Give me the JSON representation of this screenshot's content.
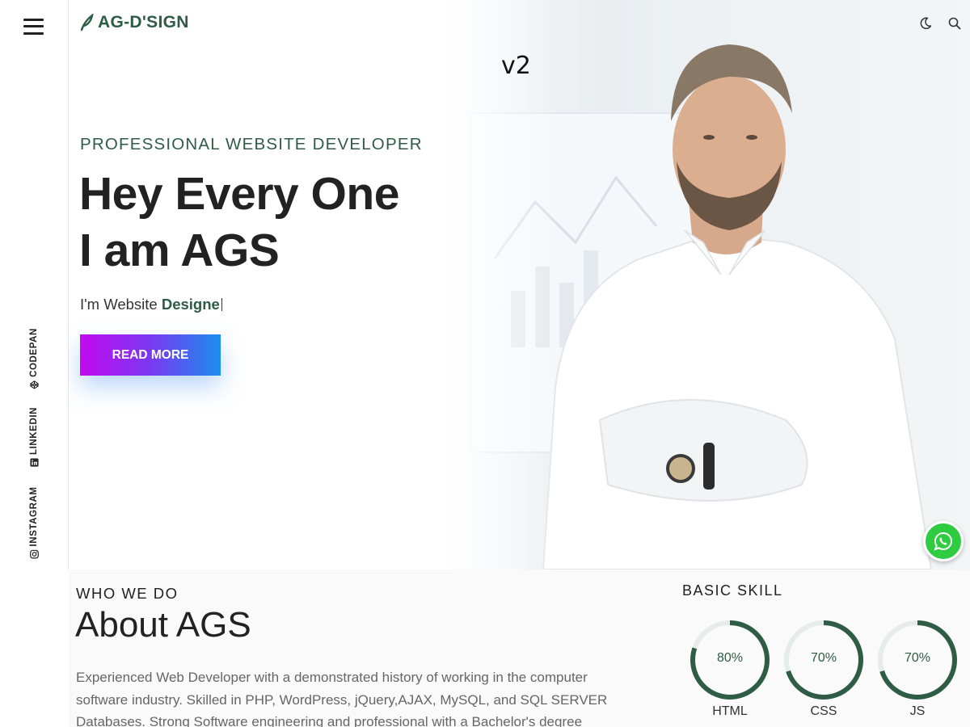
{
  "header": {
    "logo_text": "AG-D'SIGN",
    "version_label": "v2",
    "icons": [
      "menu-icon",
      "moon-icon",
      "search-icon"
    ]
  },
  "social": {
    "codepan": "CODEPAN",
    "linkedin": "LINKEDIN",
    "instagram": "INSTAGRAM"
  },
  "hero": {
    "kicker": "PROFESSIONAL WEBSITE DEVELOPER",
    "title_line1": "Hey Every One",
    "title_line2": "I am AGS",
    "subtitle_prefix": "I'm Website",
    "subtitle_typed": "Designe",
    "button_label": "READ MORE"
  },
  "about": {
    "kicker": "WHO WE DO",
    "title": "About AGS",
    "text": "Experienced Web Developer with a demonstrated history of working in the computer software industry. Skilled in PHP, WordPress, jQuery,AJAX, MySQL, and SQL SERVER Databases. Strong Software engineering and professional with a Bachelor's degree"
  },
  "skills": {
    "heading": "BASIC SKILL",
    "items": [
      {
        "label": "HTML",
        "percent_text": "80%",
        "value": 80
      },
      {
        "label": "CSS",
        "percent_text": "70%",
        "value": 70
      },
      {
        "label": "JS",
        "percent_text": "70%",
        "value": 70
      }
    ]
  },
  "colors": {
    "accent_green": "#2e5c45",
    "button_gradient": [
      "#c30af0",
      "#1a8ef0"
    ],
    "whatsapp": "#2ecc40"
  }
}
